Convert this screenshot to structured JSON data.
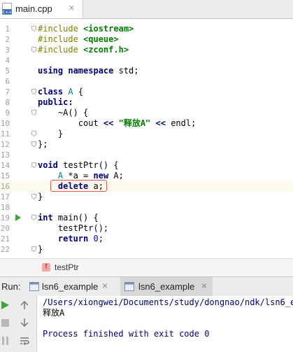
{
  "editor_tab": {
    "filename": "main.cpp",
    "close": "×",
    "icon": "cpp-file-icon"
  },
  "code_lines": [
    {
      "n": "1",
      "parts": [
        {
          "t": "#include ",
          "c": "pp"
        },
        {
          "t": "<iostream>",
          "c": "inc"
        }
      ],
      "fold": true
    },
    {
      "n": "2",
      "parts": [
        {
          "t": "#include ",
          "c": "pp"
        },
        {
          "t": "<queue>",
          "c": "inc"
        }
      ]
    },
    {
      "n": "3",
      "parts": [
        {
          "t": "#include ",
          "c": "pp"
        },
        {
          "t": "<zconf.h>",
          "c": "inc"
        }
      ],
      "fold": true
    },
    {
      "n": "4",
      "parts": []
    },
    {
      "n": "5",
      "parts": [
        {
          "t": "using ",
          "c": "kw"
        },
        {
          "t": "namespace ",
          "c": "kw"
        },
        {
          "t": "std;",
          "c": "ops"
        }
      ]
    },
    {
      "n": "6",
      "parts": []
    },
    {
      "n": "7",
      "parts": [
        {
          "t": "class ",
          "c": "kw"
        },
        {
          "t": "A",
          "c": "cls"
        },
        {
          "t": " {",
          "c": "ops"
        }
      ],
      "fold": true
    },
    {
      "n": "8",
      "parts": [
        {
          "t": "public:",
          "c": "kw"
        }
      ]
    },
    {
      "n": "9",
      "parts": [
        {
          "t": "    ~A() {",
          "c": "ops"
        }
      ],
      "fold": true
    },
    {
      "n": "10",
      "parts": [
        {
          "t": "        cout ",
          "c": "ops"
        },
        {
          "t": "<<",
          "c": "kw"
        },
        {
          "t": " ",
          "c": "ops"
        },
        {
          "t": "\"释放A\"",
          "c": "str"
        },
        {
          "t": " ",
          "c": "ops"
        },
        {
          "t": "<<",
          "c": "kw"
        },
        {
          "t": " endl;",
          "c": "ops"
        }
      ]
    },
    {
      "n": "11",
      "parts": [
        {
          "t": "    }",
          "c": "ops"
        }
      ],
      "fold": true
    },
    {
      "n": "12",
      "parts": [
        {
          "t": "};",
          "c": "ops"
        }
      ],
      "fold": true
    },
    {
      "n": "13",
      "parts": []
    },
    {
      "n": "14",
      "parts": [
        {
          "t": "void ",
          "c": "kw"
        },
        {
          "t": "testPtr() {",
          "c": "ops"
        }
      ],
      "fold": true
    },
    {
      "n": "15",
      "parts": [
        {
          "t": "    ",
          "c": "ops"
        },
        {
          "t": "A",
          "c": "cls"
        },
        {
          "t": " *a = ",
          "c": "ops"
        },
        {
          "t": "new ",
          "c": "kw"
        },
        {
          "t": "A;",
          "c": "ops"
        }
      ]
    },
    {
      "n": "16",
      "parts": [
        {
          "t": "    ",
          "c": "ops"
        },
        {
          "t": "delete ",
          "c": "kw"
        },
        {
          "t": "a;",
          "c": "ops"
        }
      ],
      "current": true,
      "highlight": true
    },
    {
      "n": "17",
      "parts": [
        {
          "t": "}",
          "c": "ops"
        }
      ],
      "fold": true
    },
    {
      "n": "18",
      "parts": []
    },
    {
      "n": "19",
      "parts": [
        {
          "t": "int ",
          "c": "kw"
        },
        {
          "t": "main() {",
          "c": "ops"
        }
      ],
      "fold": true,
      "run": true
    },
    {
      "n": "20",
      "parts": [
        {
          "t": "    testPtr();",
          "c": "ops"
        }
      ]
    },
    {
      "n": "21",
      "parts": [
        {
          "t": "    ",
          "c": "ops"
        },
        {
          "t": "return ",
          "c": "kw"
        },
        {
          "t": "0",
          "c": "num"
        },
        {
          "t": ";",
          "c": "ops"
        }
      ]
    },
    {
      "n": "22",
      "parts": [
        {
          "t": "}",
          "c": "ops"
        }
      ],
      "fold": true
    }
  ],
  "breadcrumb": {
    "badge": "f",
    "function": "testPtr"
  },
  "run_panel": {
    "label": "Run:",
    "tabs": [
      {
        "label": "lsn6_example",
        "close": "×",
        "active": false
      },
      {
        "label": "lsn6_example",
        "close": "×",
        "active": true
      }
    ],
    "console": [
      {
        "text": "/Users/xiongwei/Documents/study/dongnao/ndk/lsn6_exa",
        "style": "path"
      },
      {
        "text": "释放A",
        "style": "out"
      },
      {
        "text": "",
        "style": "out"
      },
      {
        "text": "Process finished with exit code 0",
        "style": "exit"
      }
    ]
  },
  "colors": {
    "accent_run": "#45a13e",
    "highlight_box": "#e25848",
    "keyword": "#000080",
    "string": "#008000"
  }
}
